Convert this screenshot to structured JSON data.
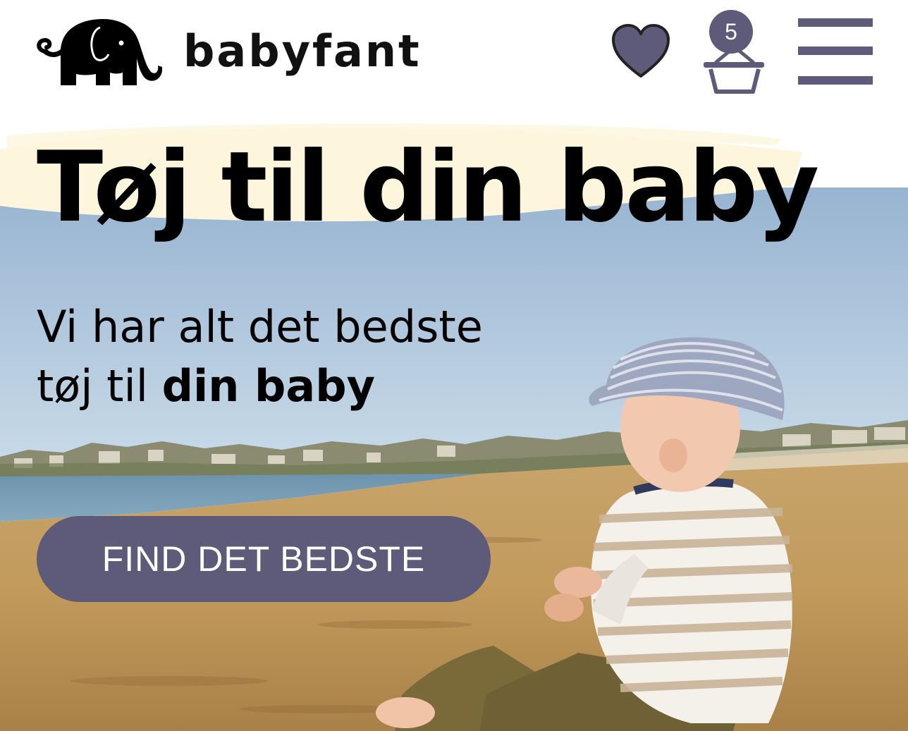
{
  "header": {
    "brand": "babyfant",
    "basket_count": "5"
  },
  "hero": {
    "title": "Tøj til din baby",
    "subtitle_line1": "Vi har alt det bedste",
    "subtitle_line2_regular": "tøj til ",
    "subtitle_line2_bold": "din baby",
    "cta_label": "FIND DET BEDSTE"
  },
  "colors": {
    "accent": "#5d5a7a",
    "brush_highlight": "#fdf6dc",
    "sky": "#a9c3dc",
    "sand": "#c9a468"
  },
  "icons": [
    "elephant-logo-icon",
    "heart-icon",
    "basket-icon",
    "hamburger-menu-icon"
  ]
}
